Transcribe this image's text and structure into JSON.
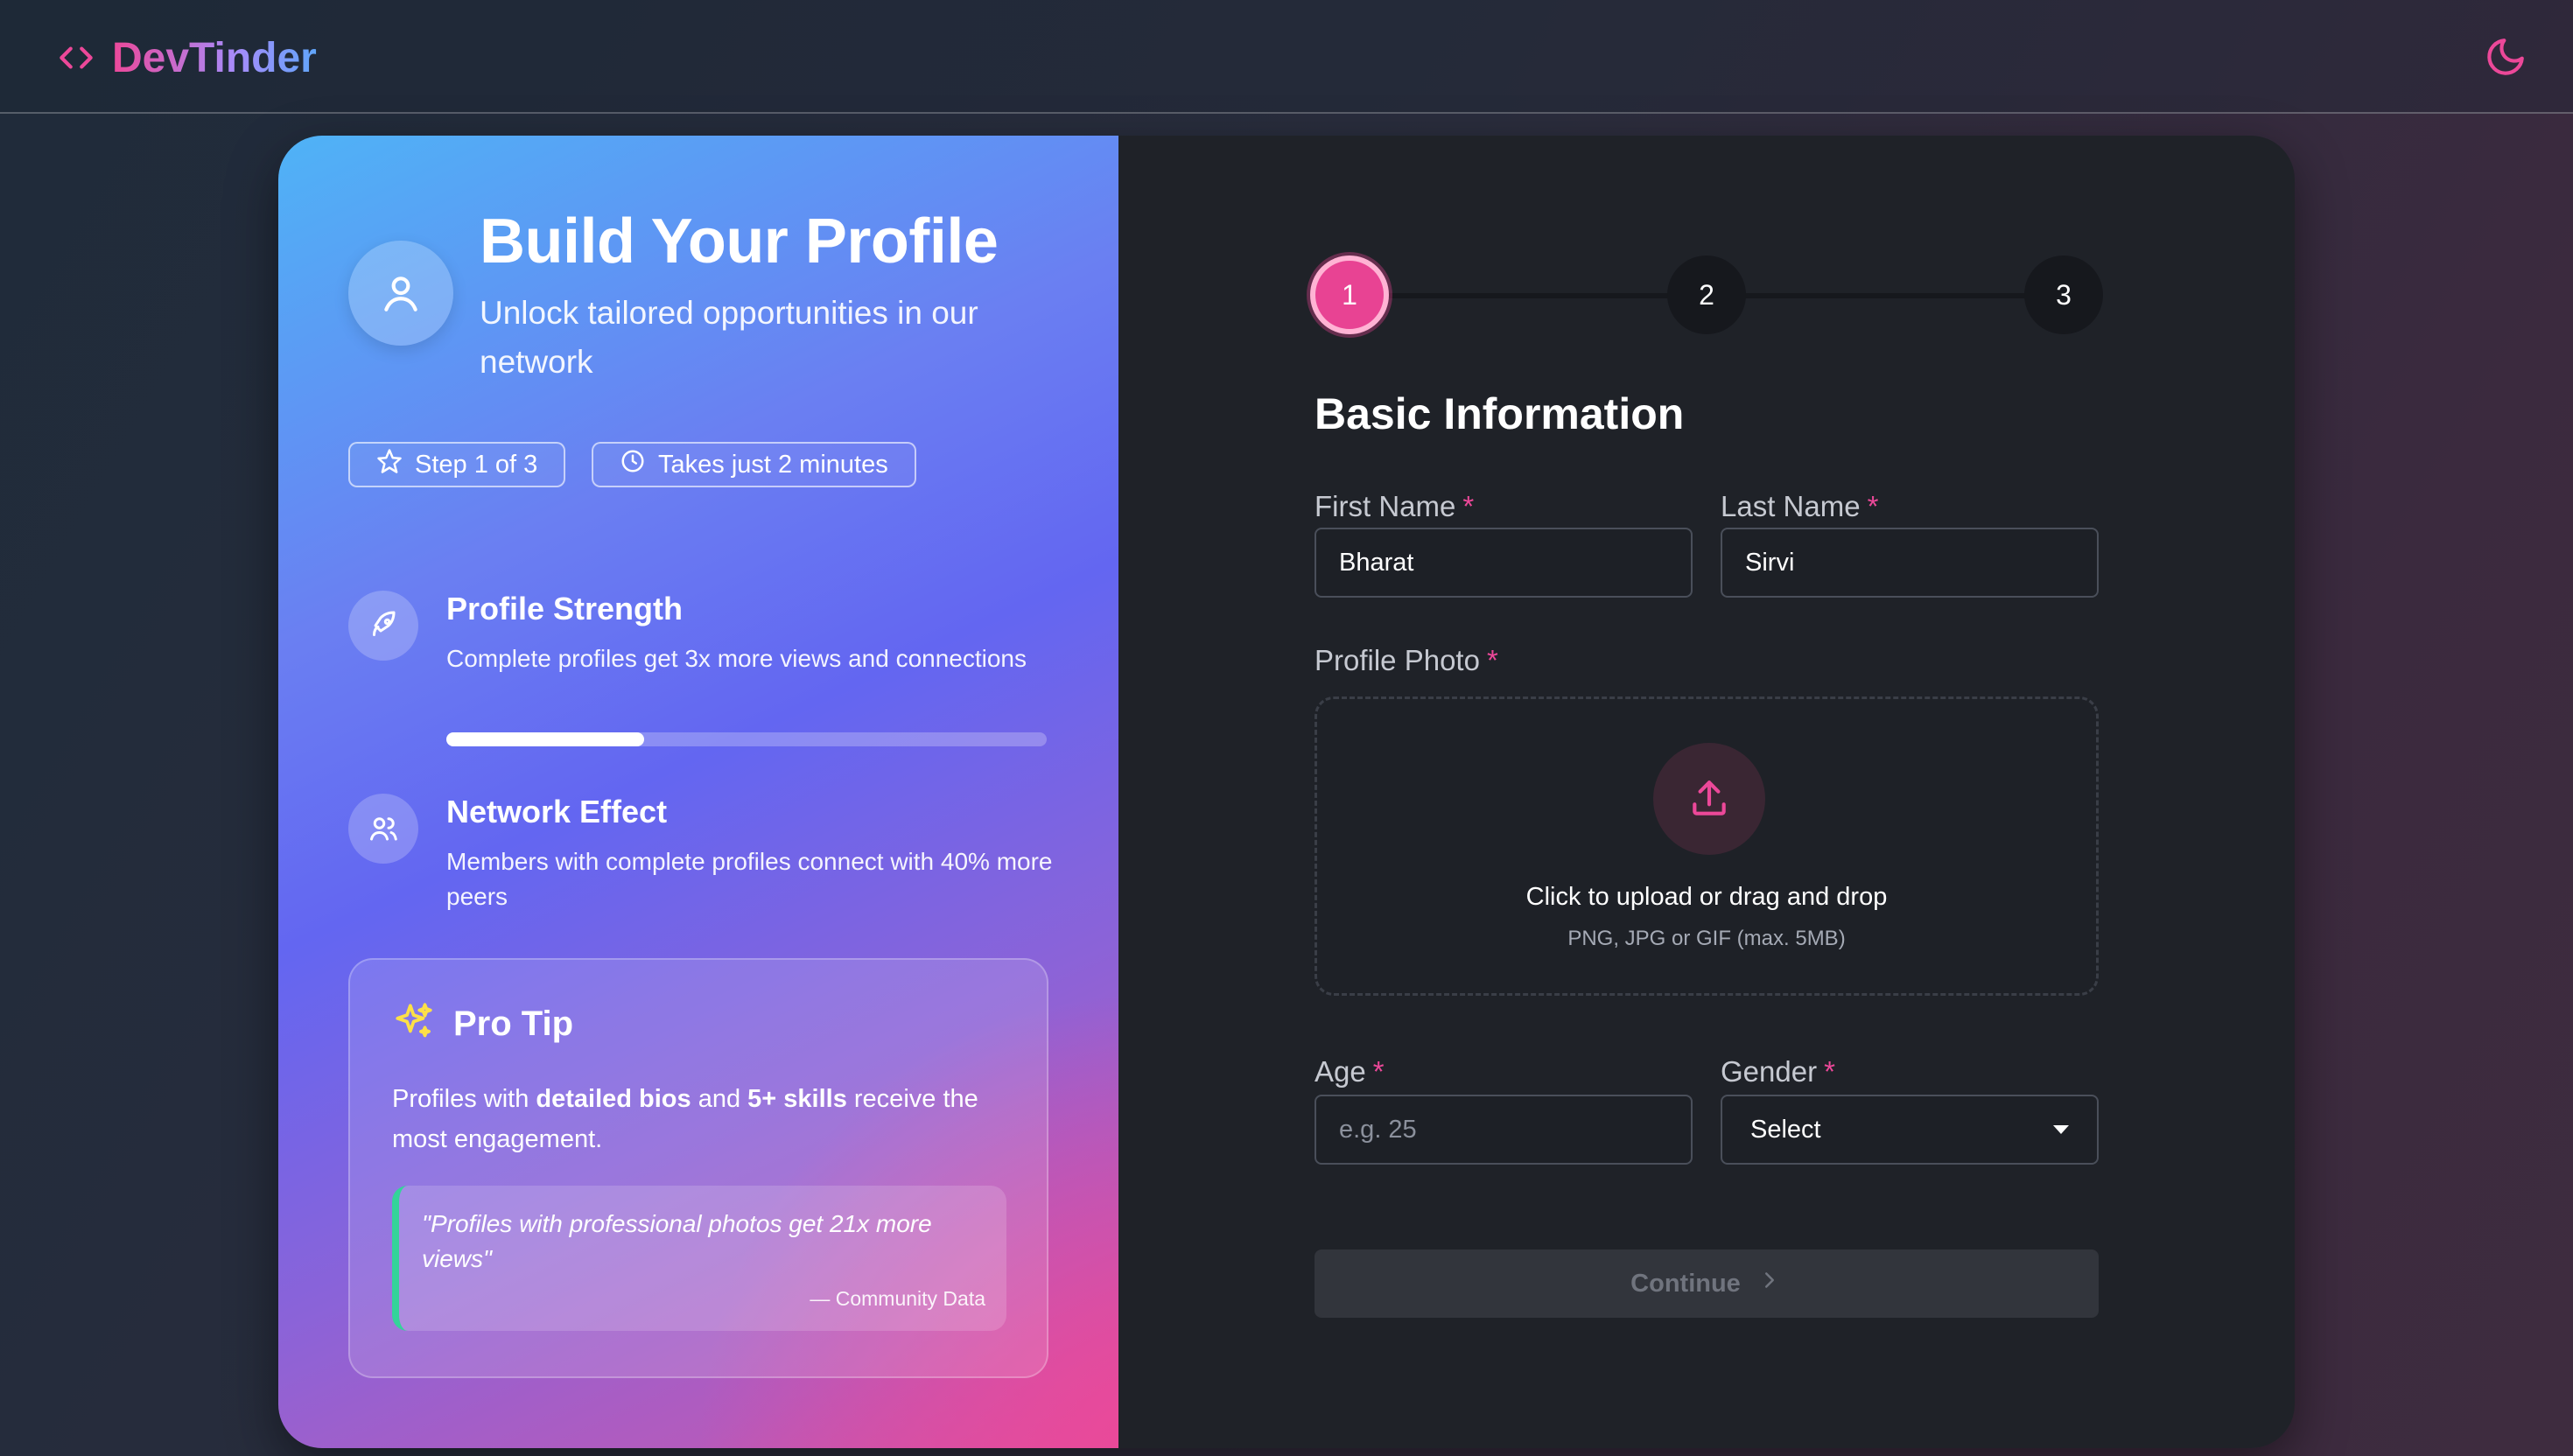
{
  "app": {
    "brand": "DevTinder"
  },
  "colors": {
    "accent": "#ec4899",
    "panel_dark": "#1f2228",
    "gradient_start": "#4fb3f6",
    "gradient_mid": "#6366f1",
    "gradient_end": "#d9509f"
  },
  "icons": {
    "brand": "code-brackets-icon",
    "theme": "moon-icon"
  },
  "intro": {
    "title": "Build Your Profile",
    "subtitle": "Unlock tailored opportunities in our network",
    "step_pill": "Step 1 of 3",
    "time_pill": "Takes just 2 minutes"
  },
  "features": {
    "strength": {
      "title": "Profile Strength",
      "desc": "Complete profiles get 3x more views and connections",
      "progress": 0.33
    },
    "network": {
      "title": "Network Effect",
      "desc": "Members with complete profiles connect with 40% more peers"
    }
  },
  "tip": {
    "title": "Pro Tip",
    "body_pre": "Profiles with ",
    "body_b1": "detailed bios",
    "body_mid": " and ",
    "body_b2": "5+ skills",
    "body_post": " receive the most engagement.",
    "quote": "\"Profiles with professional photos get 21x more views\"",
    "quote_source": "— Community Data"
  },
  "stepper": {
    "steps": [
      "1",
      "2",
      "3"
    ],
    "active": 1
  },
  "form": {
    "section_title": "Basic Information",
    "required_mark": "*",
    "first_name": {
      "label": "First Name",
      "value": "Bharat"
    },
    "last_name": {
      "label": "Last Name",
      "value": "Sirvi"
    },
    "photo": {
      "label": "Profile Photo",
      "main": "Click to upload or drag and drop",
      "sub": "PNG, JPG or GIF (max. 5MB)"
    },
    "age": {
      "label": "Age",
      "placeholder": "e.g. 25"
    },
    "gender": {
      "label": "Gender",
      "selected": "Select"
    },
    "continue_label": "Continue"
  }
}
